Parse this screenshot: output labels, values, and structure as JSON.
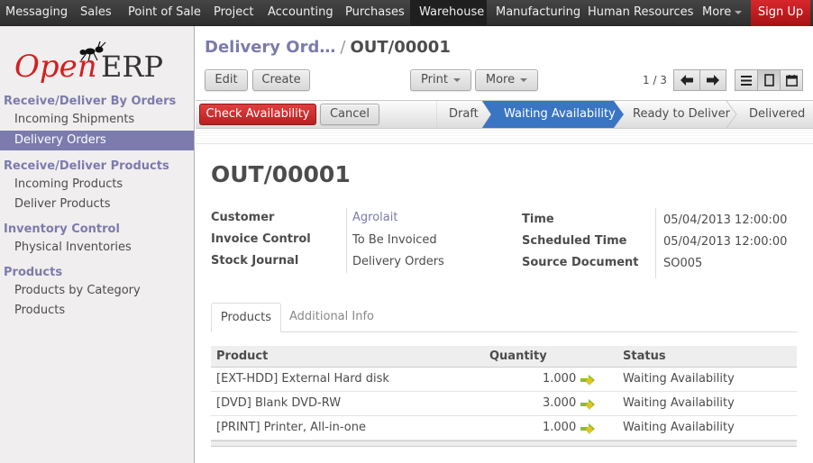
{
  "topbar": {
    "menu": [
      {
        "label": "Messaging"
      },
      {
        "label": "Sales"
      },
      {
        "label": "Point of Sale"
      },
      {
        "label": "Project"
      },
      {
        "label": "Accounting"
      },
      {
        "label": "Purchases"
      },
      {
        "label": "Warehouse",
        "active": true
      },
      {
        "label": "Manufacturing"
      },
      {
        "label": "Human Resources"
      },
      {
        "label": "More"
      }
    ],
    "signup_label": "Sign Up"
  },
  "sidebar": {
    "logo_text_left": "Open",
    "logo_text_right": "ERP",
    "sections": [
      {
        "header": "Receive/Deliver By Orders",
        "items": [
          "Incoming Shipments",
          "Delivery Orders"
        ]
      },
      {
        "header": "Receive/Deliver Products",
        "items": [
          "Incoming Products",
          "Deliver Products"
        ]
      },
      {
        "header": "Inventory Control",
        "items": [
          "Physical Inventories"
        ]
      },
      {
        "header": "Products",
        "items": [
          "Products by Category",
          "Products"
        ]
      }
    ],
    "active_item": "Delivery Orders"
  },
  "breadcrumb": {
    "parent": "Delivery Ord…",
    "separator": "/",
    "current": "OUT/00001"
  },
  "toolbar": {
    "edit_label": "Edit",
    "create_label": "Create",
    "print_label": "Print",
    "more_label": "More",
    "pager_text": "1 / 3"
  },
  "actions": {
    "check_availability_label": "Check Availability",
    "cancel_label": "Cancel"
  },
  "stages": [
    {
      "label": "Draft"
    },
    {
      "label": "Waiting Availability",
      "current": true
    },
    {
      "label": "Ready to Deliver"
    },
    {
      "label": "Delivered"
    }
  ],
  "record": {
    "title": "OUT/00001",
    "left_fields": [
      {
        "label": "Customer",
        "value": "Agrolait",
        "link": true
      },
      {
        "label": "Invoice Control",
        "value": "To Be Invoiced"
      },
      {
        "label": "Stock Journal",
        "value": "Delivery Orders"
      }
    ],
    "right_fields": [
      {
        "label": "Time",
        "value": "05/04/2013 12:00:00"
      },
      {
        "label": "Scheduled Time",
        "value": "05/04/2013 12:00:00"
      },
      {
        "label": "Source Document",
        "value": "SO005"
      }
    ]
  },
  "tabs": [
    {
      "label": "Products",
      "active": true
    },
    {
      "label": "Additional Info"
    }
  ],
  "table": {
    "columns": [
      "Product",
      "Quantity",
      "Status"
    ],
    "rows": [
      {
        "product": "[EXT-HDD] External Hard disk",
        "quantity": "1.000",
        "status": "Waiting Availability"
      },
      {
        "product": "[DVD] Blank DVD-RW",
        "quantity": "3.000",
        "status": "Waiting Availability"
      },
      {
        "product": "[PRINT] Printer, All-in-one",
        "quantity": "1.000",
        "status": "Waiting Availability"
      }
    ]
  },
  "colors": {
    "accent": "#7c7bad",
    "danger": "#c52323",
    "stage_current": "#3a75c3"
  }
}
